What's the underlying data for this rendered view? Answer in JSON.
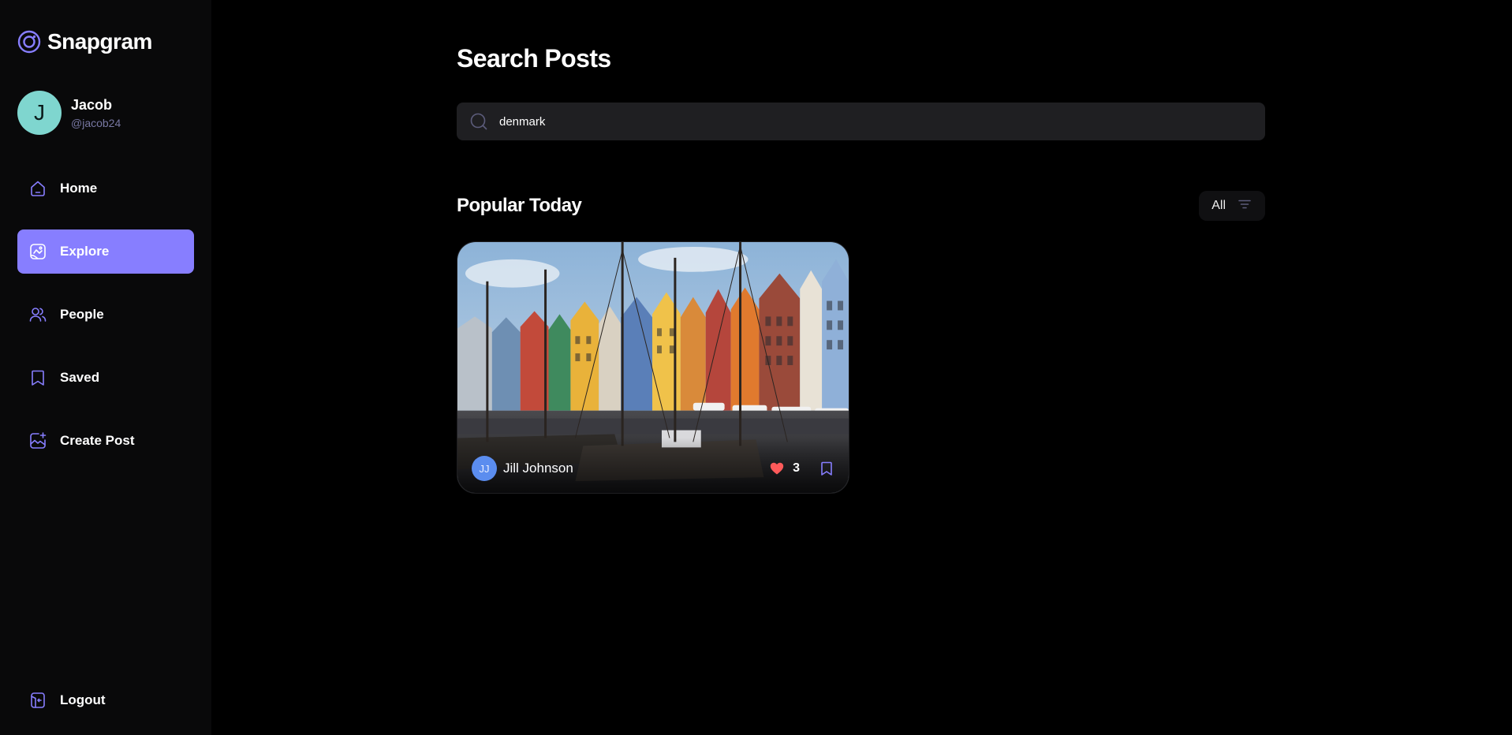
{
  "app": {
    "name": "Snapgram"
  },
  "user": {
    "initial": "J",
    "name": "Jacob",
    "handle": "@jacob24"
  },
  "nav": {
    "items": [
      {
        "label": "Home",
        "icon": "home-icon"
      },
      {
        "label": "Explore",
        "icon": "explore-icon",
        "active": true
      },
      {
        "label": "People",
        "icon": "people-icon"
      },
      {
        "label": "Saved",
        "icon": "bookmark-icon"
      },
      {
        "label": "Create Post",
        "icon": "create-post-icon"
      }
    ],
    "logout": "Logout"
  },
  "page": {
    "title": "Search Posts"
  },
  "search": {
    "value": "denmark",
    "placeholder": "Search"
  },
  "section": {
    "title": "Popular Today",
    "filter_label": "All"
  },
  "posts": [
    {
      "creator_initials": "JJ",
      "creator_name": "Jill Johnson",
      "likes": "3",
      "image_subject": "Colorful harbor houses with sailboats"
    }
  ],
  "colors": {
    "accent": "#877eff",
    "sidebar_bg": "#09090a",
    "search_bg": "#1f1f22",
    "like": "#ff5a5a",
    "avatar": "#7fd6cf"
  }
}
